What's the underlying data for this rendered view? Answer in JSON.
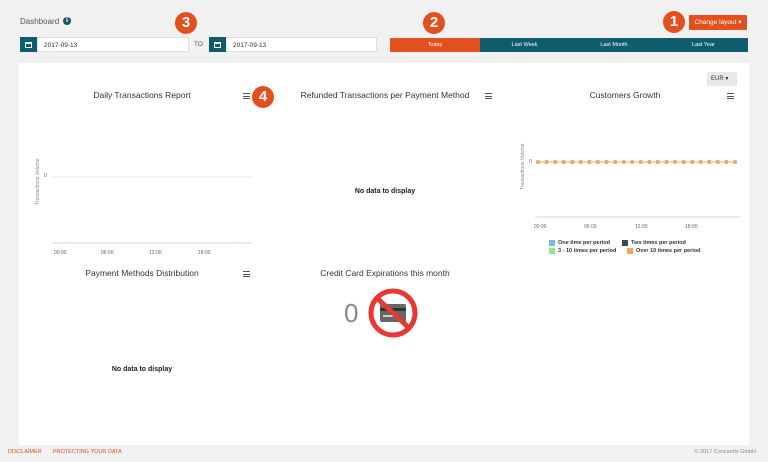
{
  "header": {
    "title": "Dashboard",
    "info_icon": "i",
    "change_layout": "Change layout ▾"
  },
  "badges": [
    "1",
    "2",
    "3",
    "4"
  ],
  "date_range": {
    "from": "2017-09-13",
    "to_label": "TO",
    "to": "2017-09-13"
  },
  "range_buttons": [
    "Today",
    "Last Week",
    "Last Month",
    "Last Year"
  ],
  "currency": "EUR",
  "charts": {
    "daily": {
      "title": "Daily Transactions Report",
      "ylabel": "Transactions Volume",
      "y_tick": "0",
      "x_ticks": [
        "00:00",
        "06:00",
        "12:00",
        "18:00"
      ]
    },
    "refunded": {
      "title": "Refunded Transactions per Payment Method",
      "no_data": "No data to display"
    },
    "customers": {
      "title": "Customers Growth",
      "ylabel": "Transactions Volume",
      "y_tick": "0",
      "x_ticks": [
        "00:00",
        "06:00",
        "12:00",
        "18:00"
      ],
      "legend": [
        "One time per period",
        "Two times per period",
        "3 - 10 times per period",
        "Over 10 times per period"
      ]
    },
    "payment": {
      "title": "Payment Methods Distribution",
      "no_data": "No data to display"
    },
    "credit": {
      "title": "Credit Card Expirations this month",
      "value": "0"
    }
  },
  "chart_data": {
    "type": "line",
    "x": [
      "00:00",
      "01:00",
      "02:00",
      "03:00",
      "04:00",
      "05:00",
      "06:00",
      "07:00",
      "08:00",
      "09:00",
      "10:00",
      "11:00",
      "12:00",
      "13:00",
      "14:00",
      "15:00",
      "16:00",
      "17:00",
      "18:00",
      "19:00",
      "20:00",
      "21:00",
      "22:00",
      "23:00"
    ],
    "series": [
      {
        "name": "One time per period",
        "values": [
          0,
          0,
          0,
          0,
          0,
          0,
          0,
          0,
          0,
          0,
          0,
          0,
          0,
          0,
          0,
          0,
          0,
          0,
          0,
          0,
          0,
          0,
          0,
          0
        ]
      },
      {
        "name": "Two times per period",
        "values": [
          0,
          0,
          0,
          0,
          0,
          0,
          0,
          0,
          0,
          0,
          0,
          0,
          0,
          0,
          0,
          0,
          0,
          0,
          0,
          0,
          0,
          0,
          0,
          0
        ]
      },
      {
        "name": "3 - 10 times per period",
        "values": [
          0,
          0,
          0,
          0,
          0,
          0,
          0,
          0,
          0,
          0,
          0,
          0,
          0,
          0,
          0,
          0,
          0,
          0,
          0,
          0,
          0,
          0,
          0,
          0
        ]
      },
      {
        "name": "Over 10 times per period",
        "values": [
          0,
          0,
          0,
          0,
          0,
          0,
          0,
          0,
          0,
          0,
          0,
          0,
          0,
          0,
          0,
          0,
          0,
          0,
          0,
          0,
          0,
          0,
          0,
          0
        ]
      }
    ],
    "title": "Customers Growth",
    "ylabel": "Transactions Volume"
  },
  "colors": {
    "accent": "#e2501d",
    "teal": "#0f5c6e",
    "legend": [
      "#7cb5ec",
      "#434348",
      "#90ed7d",
      "#f7a35c"
    ]
  },
  "footer": {
    "disclaimer": "DISCLAIMER",
    "protecting": "PROTECTING YOUR DATA",
    "copyright": "© 2017 Concardis GmbH"
  }
}
